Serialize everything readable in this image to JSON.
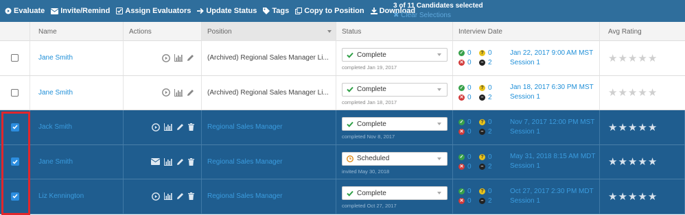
{
  "toolbar": {
    "items": [
      {
        "label": "Evaluate",
        "icon": "play-circle-icon"
      },
      {
        "label": "Invite/Remind",
        "icon": "envelope-icon"
      },
      {
        "label": "Assign Evaluators",
        "icon": "checkbox-icon"
      },
      {
        "label": "Update Status",
        "icon": "arrow-right-icon"
      },
      {
        "label": "Tags",
        "icon": "tag-icon"
      },
      {
        "label": "Copy to Position",
        "icon": "copy-icon"
      },
      {
        "label": "Download",
        "icon": "download-icon"
      }
    ],
    "selection_count": "3 of 11 Candidates selected",
    "clear_label": "✖ Clear Selections"
  },
  "columns": {
    "name": "Name",
    "actions": "Actions",
    "position": "Position",
    "status": "Status",
    "interview_date": "Interview Date",
    "avg_rating": "Avg Rating"
  },
  "rows": [
    {
      "name": "Jane Smith",
      "selected": false,
      "position": "(Archived) Regional Sales Manager Li...",
      "status": "Complete",
      "status_icon": "check-icon",
      "status_sub": "completed Jan 19, 2017",
      "counts": {
        "green": "0",
        "yellow": "0",
        "red": "0",
        "black": "2"
      },
      "date": "Jan 22, 2017 9:00 AM MST",
      "session": "Session 1",
      "rating": 0
    },
    {
      "name": "Jane Smith",
      "selected": false,
      "position": "(Archived) Regional Sales Manager Li...",
      "status": "Complete",
      "status_icon": "check-icon",
      "status_sub": "completed Jan 18, 2017",
      "counts": {
        "green": "0",
        "yellow": "0",
        "red": "0",
        "black": "2"
      },
      "date": "Jan 18, 2017 6:30 PM MST",
      "session": "Session 1",
      "rating": 0
    },
    {
      "name": "Jack Smith",
      "selected": true,
      "position": "Regional Sales Manager",
      "status": "Complete",
      "status_icon": "check-icon",
      "status_sub": "completed Nov 8, 2017",
      "counts": {
        "green": "0",
        "yellow": "0",
        "red": "0",
        "black": "2"
      },
      "date": "Nov 7, 2017 12:00 PM MST",
      "session": "Session 1",
      "rating": 0
    },
    {
      "name": "Jane Smith",
      "selected": true,
      "position": "Regional Sales Manager",
      "status": "Scheduled",
      "status_icon": "clock-icon",
      "status_sub": "invited May 30, 2018",
      "counts": {
        "green": "0",
        "yellow": "0",
        "red": "0",
        "black": "2"
      },
      "date": "May 31, 2018 8:15 AM MDT",
      "session": "Session 1",
      "rating": 0
    },
    {
      "name": "Liz Kennington",
      "selected": true,
      "position": "Regional Sales Manager",
      "status": "Complete",
      "status_icon": "check-icon",
      "status_sub": "completed Oct 27, 2017",
      "counts": {
        "green": "0",
        "yellow": "0",
        "red": "0",
        "black": "2"
      },
      "date": "Oct 27, 2017 2:30 PM MDT",
      "session": "Session 1",
      "rating": 0
    }
  ],
  "colors": {
    "toolbar": "#2f6e9c",
    "selected_row": "#1f5d8f",
    "link": "#1f8fd8",
    "highlight": "#e0272c"
  }
}
